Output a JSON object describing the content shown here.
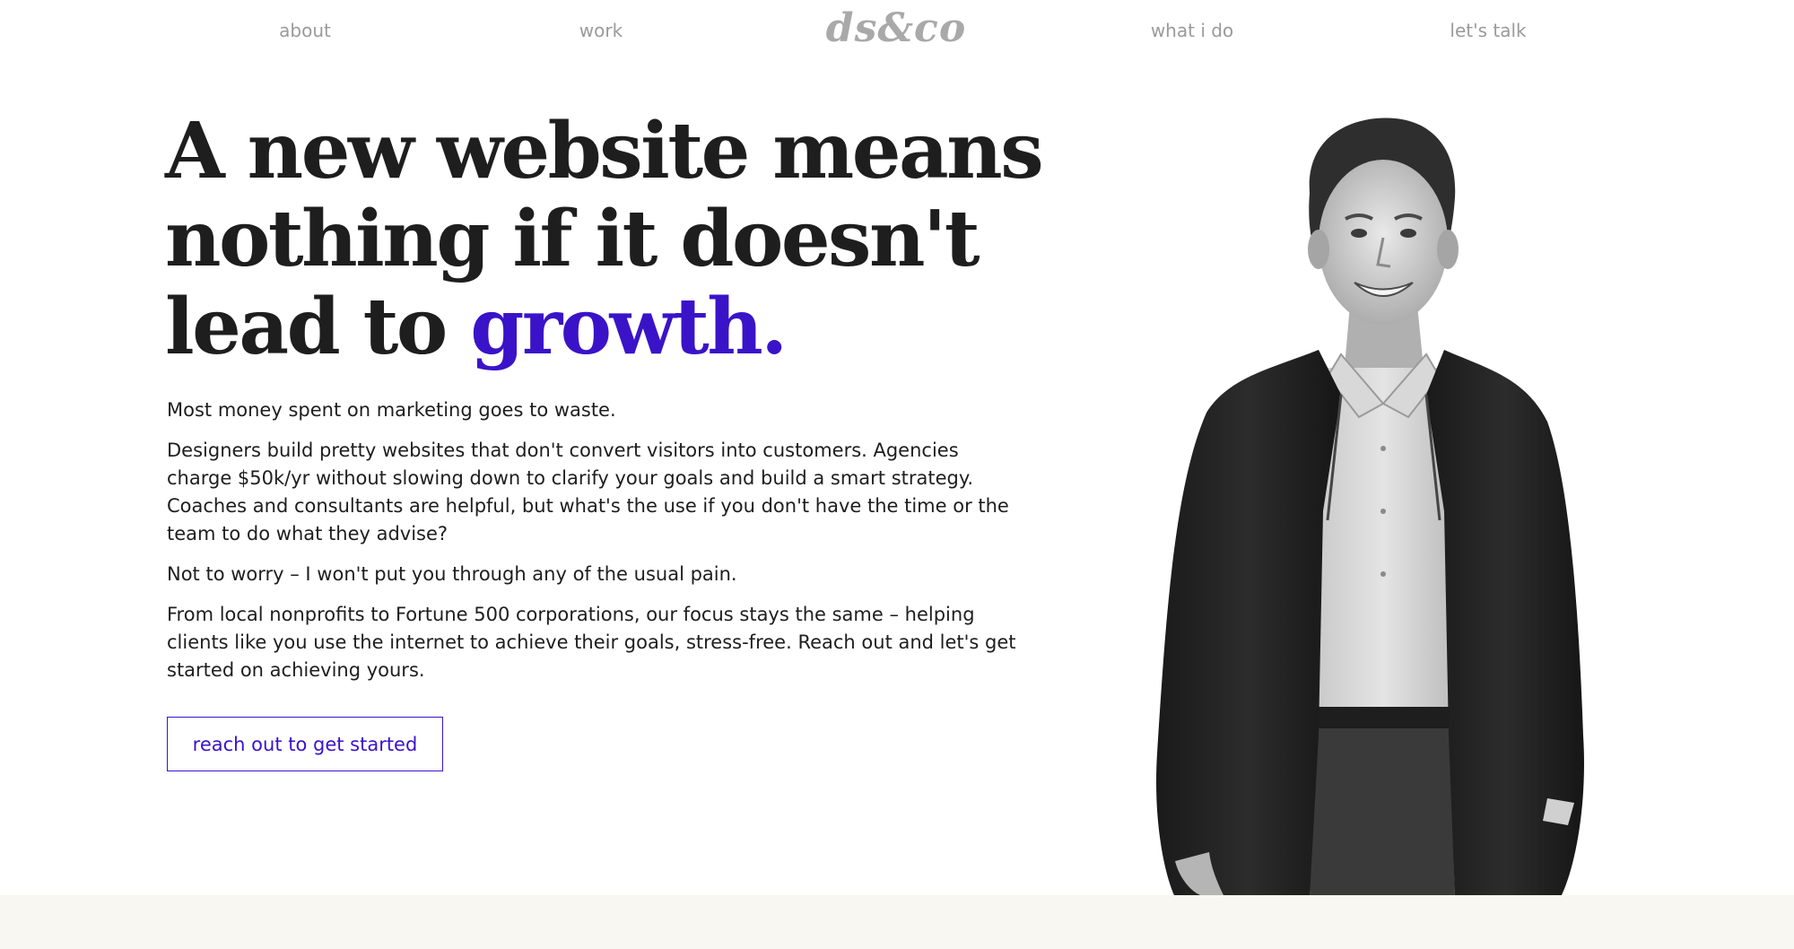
{
  "nav": {
    "about": "about",
    "work": "work",
    "logo": "ds&co",
    "what_i_do": "what i do",
    "lets_talk": "let's talk"
  },
  "hero": {
    "headline_line1": "A new website means",
    "headline_line2": "nothing if it doesn't",
    "headline_line3_prefix": "lead to ",
    "headline_accent": "growth.",
    "paragraphs": [
      "Most money spent on marketing goes to waste.",
      "Designers build pretty websites that don't convert visitors into customers. Agencies charge $50k/yr without slowing down to clarify your goals and build a smart strategy. Coaches and consultants are helpful, but what's the use if you don't have the time or the team to do what they advise?",
      "Not to worry – I won't put you through any of the usual pain.",
      "From local nonprofits to Fortune 500 corporations, our focus stays the same – helping clients like you use the internet to achieve their goals, stress-free. Reach out and let's get started on achieving yours."
    ],
    "cta_label": "reach out to get started"
  },
  "colors": {
    "accent": "#3a13c9",
    "text": "#1e1e1e",
    "nav": "#9a9a9a",
    "logo": "#a9a9a9",
    "band": "#f8f7f1"
  }
}
